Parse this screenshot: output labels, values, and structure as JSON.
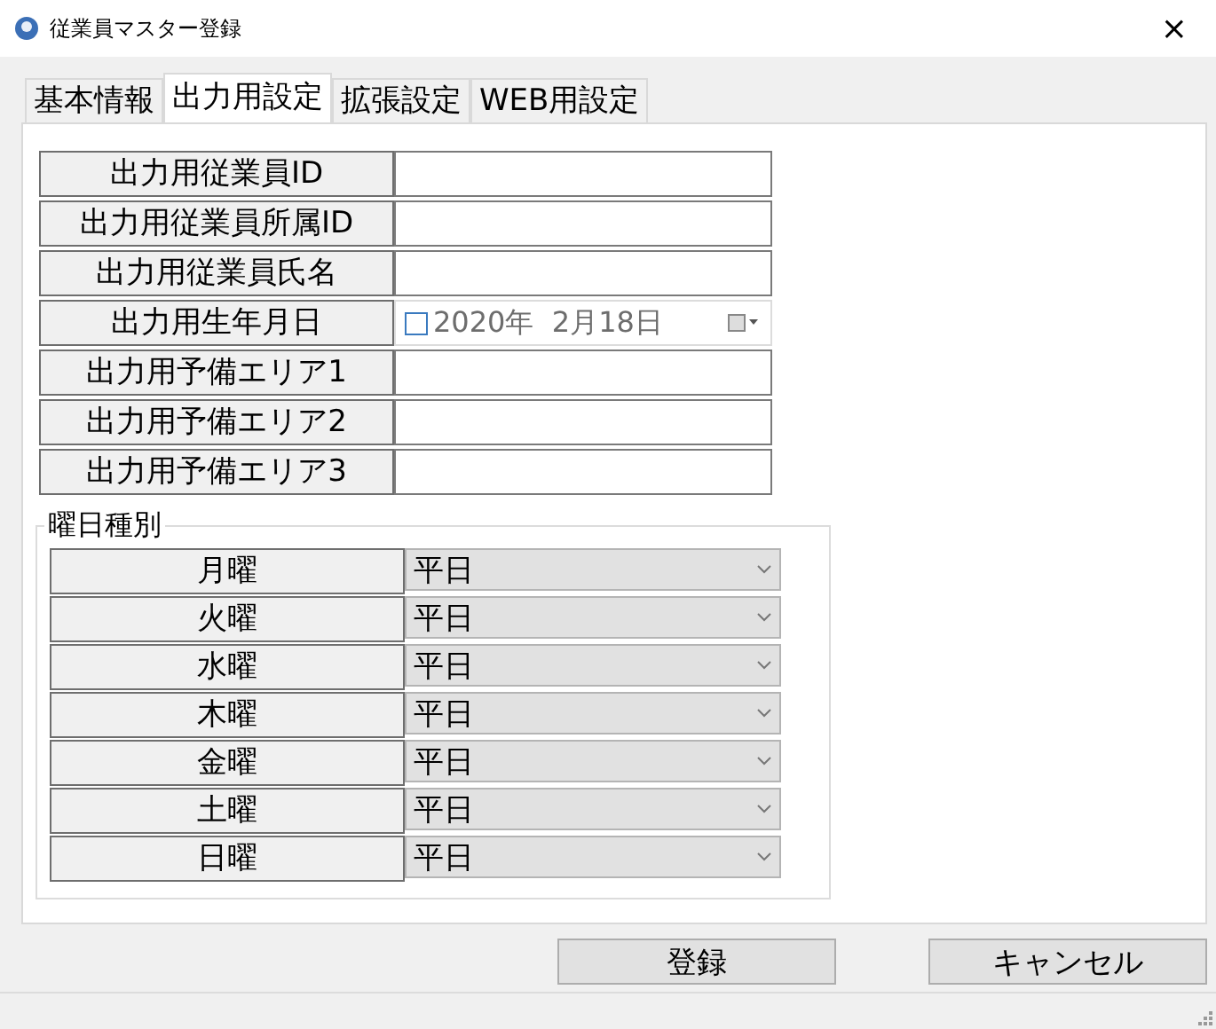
{
  "window": {
    "title": "従業員マスター登録",
    "close": "×"
  },
  "tabs": [
    {
      "label": "基本情報",
      "selected": false
    },
    {
      "label": "出力用設定",
      "selected": true
    },
    {
      "label": "拡張設定",
      "selected": false
    },
    {
      "label": "WEB用設定",
      "selected": false
    }
  ],
  "fields": [
    {
      "kind": "text",
      "label": "出力用従業員ID"
    },
    {
      "kind": "text",
      "label": "出力用従業員所属ID"
    },
    {
      "kind": "text",
      "label": "出力用従業員氏名"
    },
    {
      "kind": "date",
      "label": "出力用生年月日",
      "value": "2020年  2月18日",
      "checked": false
    },
    {
      "kind": "text",
      "label": "出力用予備エリア1"
    },
    {
      "kind": "text",
      "label": "出力用予備エリア2"
    },
    {
      "kind": "text",
      "label": "出力用予備エリア3"
    }
  ],
  "day_types": {
    "title": "曜日種別",
    "rows": [
      {
        "label": "月曜",
        "value": "平日"
      },
      {
        "label": "火曜",
        "value": "平日"
      },
      {
        "label": "水曜",
        "value": "平日"
      },
      {
        "label": "木曜",
        "value": "平日"
      },
      {
        "label": "金曜",
        "value": "平日"
      },
      {
        "label": "土曜",
        "value": "平日"
      },
      {
        "label": "日曜",
        "value": "平日"
      }
    ]
  },
  "buttons": [
    "登録",
    "キャンセル"
  ]
}
